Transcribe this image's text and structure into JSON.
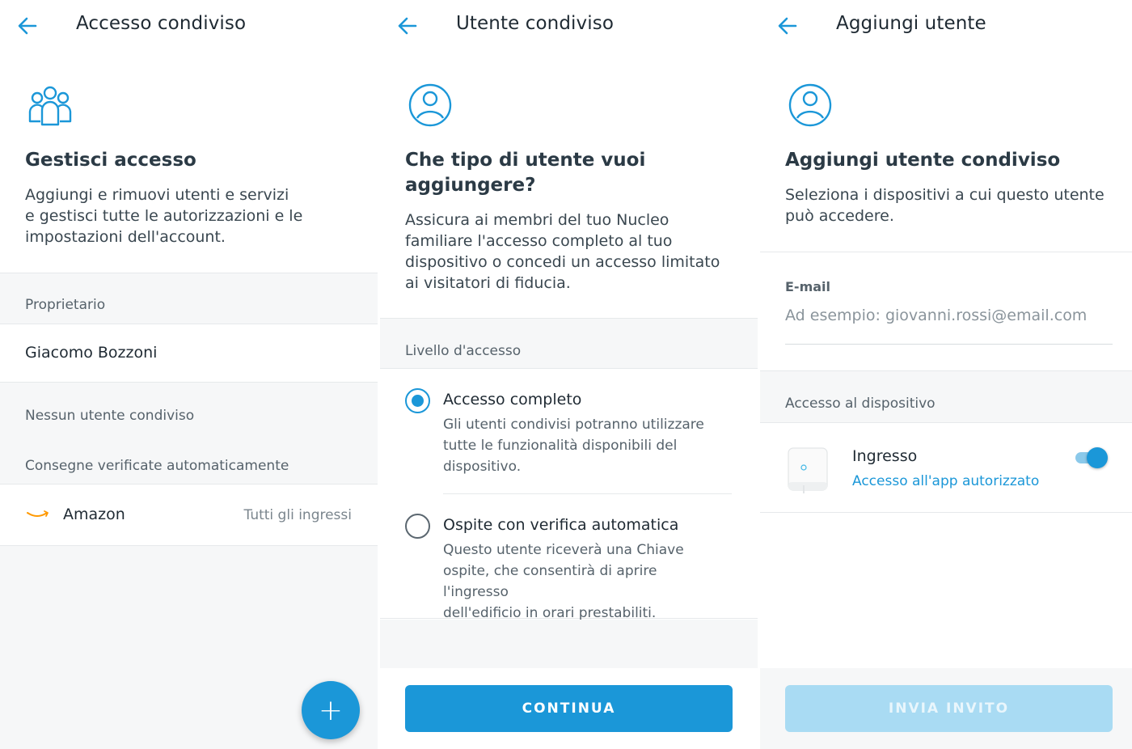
{
  "panel1": {
    "title": "Accesso condiviso",
    "heading": "Gestisci accesso",
    "description_lines": [
      "Aggiungi e rimuovi utenti e servizi",
      "e gestisci tutte le autorizzazioni e le",
      "impostazioni dell'account."
    ],
    "owner_label": "Proprietario",
    "owner_name": "Giacomo Bozzoni",
    "no_shared_users": "Nessun utente condiviso",
    "auto_deliveries_label": "Consegne verificate automaticamente",
    "service_name": "Amazon",
    "service_scope": "Tutti gli ingressi",
    "fab_label": "+"
  },
  "panel2": {
    "title": "Utente condiviso",
    "heading_lines": [
      "Che tipo di utente vuoi",
      "aggiungere?"
    ],
    "description_lines": [
      "Assicura ai membri del tuo Nucleo",
      "familiare l'accesso completo al tuo",
      "dispositivo o concedi un accesso limitato",
      "ai visitatori di fiducia."
    ],
    "access_level_label": "Livello d'accesso",
    "options": [
      {
        "title": "Accesso completo",
        "desc_lines": [
          "Gli utenti condivisi potranno utilizzare",
          "tutte le funzionalità disponibili del",
          "dispositivo."
        ],
        "selected": true
      },
      {
        "title": "Ospite con verifica automatica",
        "desc_lines": [
          "Questo utente riceverà una Chiave",
          "ospite, che consentirà di aprire l'ingresso",
          "dell'edificio in orari prestabiliti."
        ],
        "selected": false
      }
    ],
    "continue_label": "CONTINUA"
  },
  "panel3": {
    "title": "Aggiungi utente",
    "heading": "Aggiungi utente condiviso",
    "description_lines": [
      "Seleziona i dispositivi a cui questo utente",
      "può accedere."
    ],
    "email_label": "E-mail",
    "email_placeholder": "Ad esempio: giovanni.rossi@email.com",
    "email_value": "",
    "device_access_label": "Accesso al dispositivo",
    "device_name": "Ingresso",
    "device_status": "Accesso all'app autorizzato",
    "device_enabled": true,
    "send_label": "INVIA INVITO"
  },
  "colors": {
    "accent": "#1b97d8",
    "accent_disabled": "#a9dbf3",
    "section_bg": "#f6f7f8",
    "amazon_orange": "#ff9900"
  },
  "icons": {
    "back": "arrow-left-icon",
    "group": "users-group-icon",
    "user": "user-circle-icon",
    "amazon": "amazon-smile-icon",
    "device": "intercom-device-icon"
  }
}
